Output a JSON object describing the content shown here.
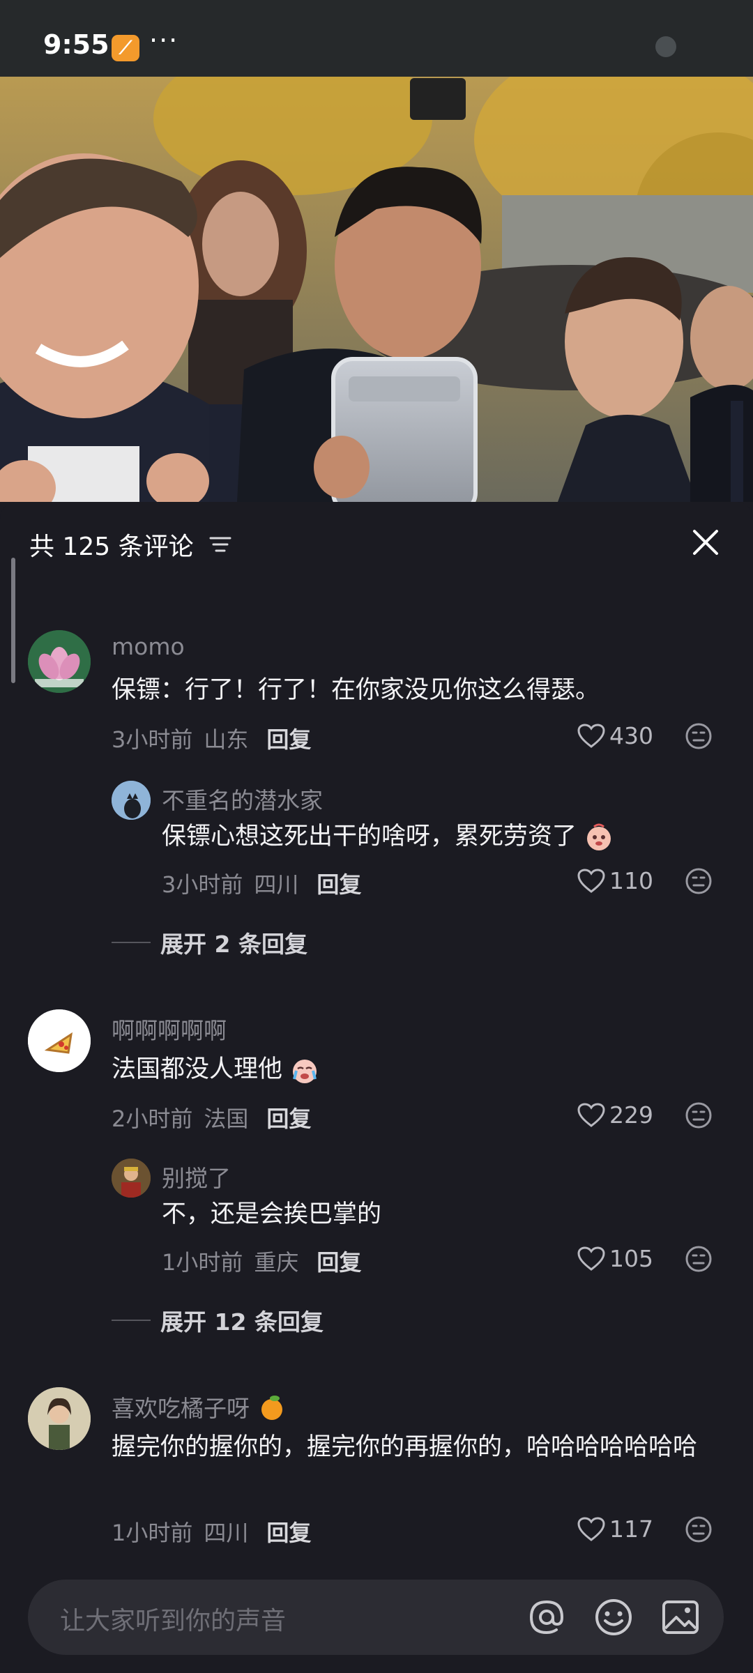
{
  "status_bar": {
    "time": "9:55",
    "more": "···"
  },
  "comments_panel": {
    "title": "共 125 条评论",
    "comments": [
      {
        "username": "momo",
        "text": "保镖：行了！行了！在你家没见你这么得瑟。",
        "time": "3小时前",
        "location": "山东",
        "reply": "回复",
        "likes": "430",
        "replies": [
          {
            "username": "不重名的潜水家",
            "text": "保镖心想这死出干的啥呀，累死劳资了",
            "time": "3小时前",
            "location": "四川",
            "reply": "回复",
            "likes": "110"
          }
        ],
        "expand": "展开 2 条回复"
      },
      {
        "username": "啊啊啊啊啊",
        "text": "法国都没人理他",
        "time": "2小时前",
        "location": "法国",
        "reply": "回复",
        "likes": "229",
        "replies": [
          {
            "username": "别搅了",
            "text": "不，还是会挨巴掌的",
            "time": "1小时前",
            "location": "重庆",
            "reply": "回复",
            "likes": "105"
          }
        ],
        "expand": "展开 12 条回复"
      },
      {
        "username": "喜欢吃橘子呀",
        "text": "握完你的握你的，握完你的再握你的，哈哈哈哈哈哈哈",
        "time": "1小时前",
        "location": "四川",
        "reply": "回复",
        "likes": "117",
        "replies": []
      }
    ]
  },
  "input_bar": {
    "placeholder": "让大家听到你的声音"
  },
  "colors": {
    "background": "#1b1b22",
    "status_bar": "#26292b",
    "input": "#2c2c33"
  }
}
